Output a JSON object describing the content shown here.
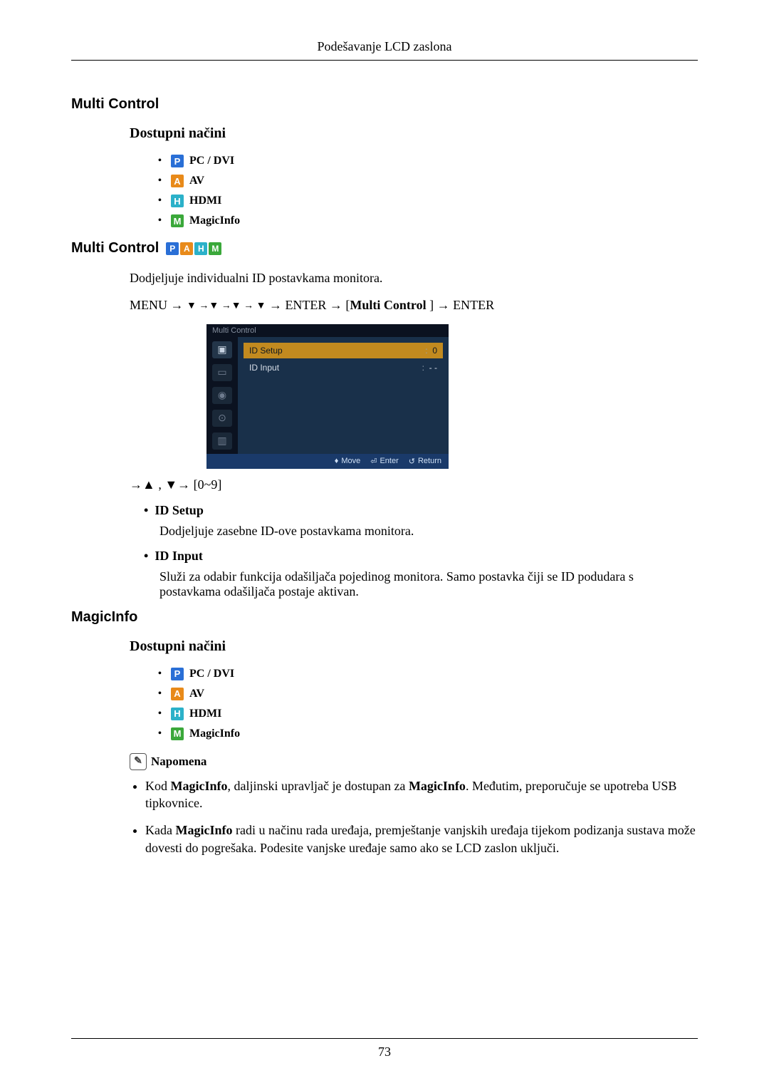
{
  "header": {
    "title": "Podešavanje LCD zaslona"
  },
  "section1": {
    "title": "Multi Control",
    "modes_heading": "Dostupni načini",
    "modes": {
      "pc": "PC / DVI",
      "av": "AV",
      "hdmi": "HDMI",
      "magicinfo": "MagicInfo"
    }
  },
  "section2": {
    "title": "Multi Control",
    "desc": "Dodjeljuje individualni ID postavkama monitora.",
    "menu_path_prefix": "MENU → ",
    "menu_path_mid": " → ENTER → [",
    "menu_path_bold": "Multi Control",
    "menu_path_suffix": " ] → ENTER",
    "osd": {
      "title": "Multi Control",
      "row1": {
        "label": "ID  Setup",
        "value": "0"
      },
      "row2": {
        "label": "ID  Input",
        "value": "- -"
      },
      "foot_move": "Move",
      "foot_enter": "Enter",
      "foot_return": "Return"
    },
    "post_nav": "→▲ , ▼→ [0~9]",
    "id_setup_label": "ID Setup",
    "id_setup_desc": "Dodjeljuje zasebne ID-ove postavkama monitora.",
    "id_input_label": "ID Input",
    "id_input_desc": "Služi za odabir funkcija odašiljača pojedinog monitora. Samo postavka čiji se ID podudara s postavkama odašiljača postaje aktivan."
  },
  "section3": {
    "title": "MagicInfo",
    "modes_heading": "Dostupni načini",
    "modes": {
      "pc": "PC / DVI",
      "av": "AV",
      "hdmi": "HDMI",
      "magicinfo": "MagicInfo"
    },
    "note_label": "Napomena",
    "note1_a": "Kod ",
    "note1_b": "MagicInfo",
    "note1_c": ", daljinski upravljač je dostupan za ",
    "note1_d": "MagicInfo",
    "note1_e": ". Međutim, preporučuje se upotreba USB tipkovnice.",
    "note2_a": "Kada ",
    "note2_b": "MagicInfo",
    "note2_c": " radi u načinu rada uređaja, premještanje vanjskih uređaja tijekom podizanja sustava može dovesti do pogrešaka. Podesite vanjske uređaje samo ako se LCD zaslon uključi."
  },
  "page_number": "73"
}
